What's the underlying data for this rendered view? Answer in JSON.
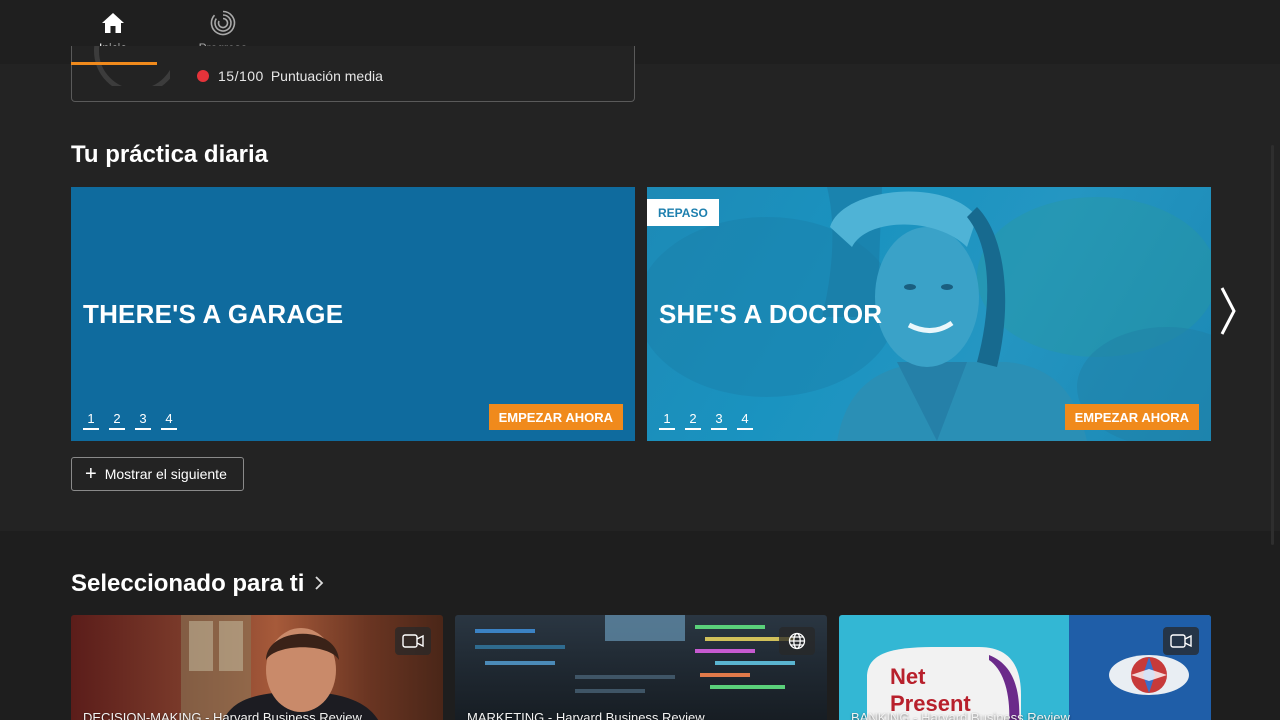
{
  "nav": {
    "items": [
      {
        "label": "Inicio",
        "icon": "home-icon",
        "active": true
      },
      {
        "label": "Progreso",
        "icon": "progress-icon",
        "active": false
      }
    ]
  },
  "score": {
    "value": "15/100",
    "label": "Puntuación media",
    "status_color": "#e4333a"
  },
  "daily": {
    "title": "Tu práctica diaria",
    "cards": [
      {
        "title": "THERE'S A GARAGE",
        "badge": "",
        "steps": [
          "1",
          "2",
          "3",
          "4"
        ],
        "cta": "EMPEZAR AHORA"
      },
      {
        "title": "SHE'S A DOCTOR",
        "badge": "REPASO",
        "steps": [
          "1",
          "2",
          "3",
          "4"
        ],
        "cta": "EMPEZAR AHORA"
      }
    ],
    "show_next": "Mostrar el siguiente"
  },
  "selected": {
    "title": "Seleccionado para ti",
    "tiles": [
      {
        "label": "DECISION-MAKING - Harvard Business Review",
        "icon": "video-icon"
      },
      {
        "label": "MARKETING - Harvard Business Review",
        "icon": "globe-icon"
      },
      {
        "label": "BANKING - Harvard Business Review",
        "icon": "video-icon",
        "image_text": "Net Present"
      }
    ]
  },
  "colors": {
    "accent": "#f08a1c",
    "card_blue": "#0f6b9e",
    "card_teal": "#1d8ab6",
    "background": "#232323"
  }
}
